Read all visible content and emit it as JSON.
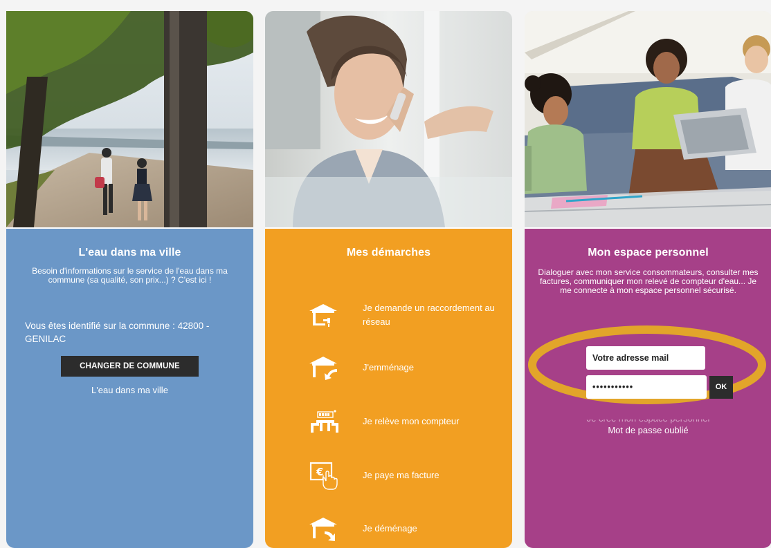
{
  "cards": {
    "ville": {
      "title": "L'eau dans ma ville",
      "description": "Besoin d'informations sur le service de l'eau dans ma commune (sa qualité, son prix...) ? C'est ici !",
      "identified_text": "Vous êtes identifié sur la commune : 42800 - GENILAC",
      "change_button": "CHANGER DE COMMUNE",
      "link": "L'eau dans ma ville",
      "color": "#6b97c7"
    },
    "demarches": {
      "title": "Mes démarches",
      "color": "#f29f22",
      "items": [
        {
          "label": "Je demande un raccordement au réseau",
          "icon": "house-tap-icon"
        },
        {
          "label": "J'emménage",
          "icon": "house-arrow-in-icon"
        },
        {
          "label": "Je relève mon compteur",
          "icon": "water-meter-icon"
        },
        {
          "label": "Je paye ma facture",
          "icon": "euro-invoice-icon"
        },
        {
          "label": "Je déménage",
          "icon": "house-arrow-out-icon"
        }
      ]
    },
    "espace": {
      "title": "Mon espace personnel",
      "description": "Dialoguer avec mon service consommateurs, consulter mes factures, communiquer mon relevé de compteur d'eau... Je me connecte à mon espace personnel sécurisé.",
      "email_placeholder": "Votre adresse mail",
      "password_value": "•••••••••••",
      "ok_button": "OK",
      "hidden_link": "Je crée mon espace personnel",
      "forgot_link": "Mot de passe oublié",
      "color": "#a64088",
      "highlight_color": "#e2a52a"
    }
  }
}
